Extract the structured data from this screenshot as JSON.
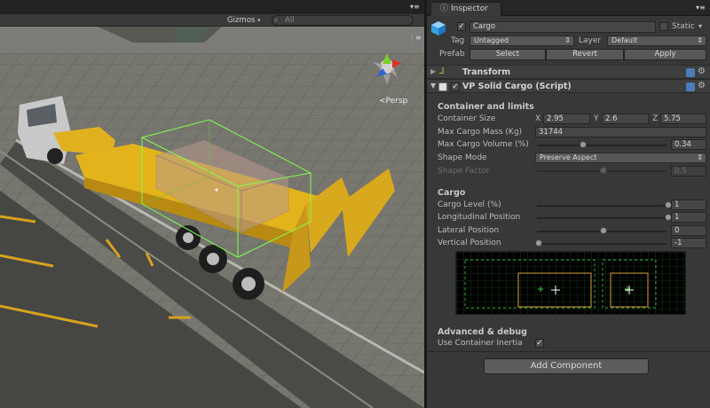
{
  "scene": {
    "gizmos_label": "Gizmos",
    "search_placeholder": "All",
    "persp_label": "Persp",
    "menu_glyph": "▾≡"
  },
  "inspector": {
    "tab_label": "Inspector",
    "object": {
      "name": "Cargo",
      "static_label": "Static",
      "tag_label": "Tag",
      "tag_value": "Untagged",
      "layer_label": "Layer",
      "layer_value": "Default",
      "prefab_label": "Prefab",
      "prefab_buttons": [
        "Select",
        "Revert",
        "Apply"
      ]
    },
    "components": {
      "transform": "Transform",
      "script": "VP Solid Cargo (Script)"
    },
    "container": {
      "heading": "Container and limits",
      "size_label": "Container Size",
      "size_x_label": "X",
      "size_x": "2.95",
      "size_y_label": "Y",
      "size_y": "2.6",
      "size_z_label": "Z",
      "size_z": "5.75",
      "mass_label": "Max Cargo Mass (Kg)",
      "mass_value": "31744",
      "volume_label": "Max Cargo Volume (%)",
      "volume_value": "0.34",
      "volume_level": 0.34,
      "shape_label": "Shape Mode",
      "shape_value": "Preserve Aspect",
      "factor_label": "Shape Factor",
      "factor_value": "0.5",
      "factor_level": 0.5
    },
    "cargo": {
      "heading": "Cargo",
      "level_label": "Cargo Level (%)",
      "level_value": "1",
      "level_level": 1.0,
      "long_label": "Longitudinal Position",
      "long_value": "1",
      "long_level": 1.0,
      "lat_label": "Lateral Position",
      "lat_value": "0",
      "lat_level": 0.5,
      "vert_label": "Vertical Position",
      "vert_value": "-1",
      "vert_level": 0.0
    },
    "advanced": {
      "heading": "Advanced & debug",
      "inertia_label": "Use Container Inertia"
    },
    "add_component": "Add Component"
  }
}
